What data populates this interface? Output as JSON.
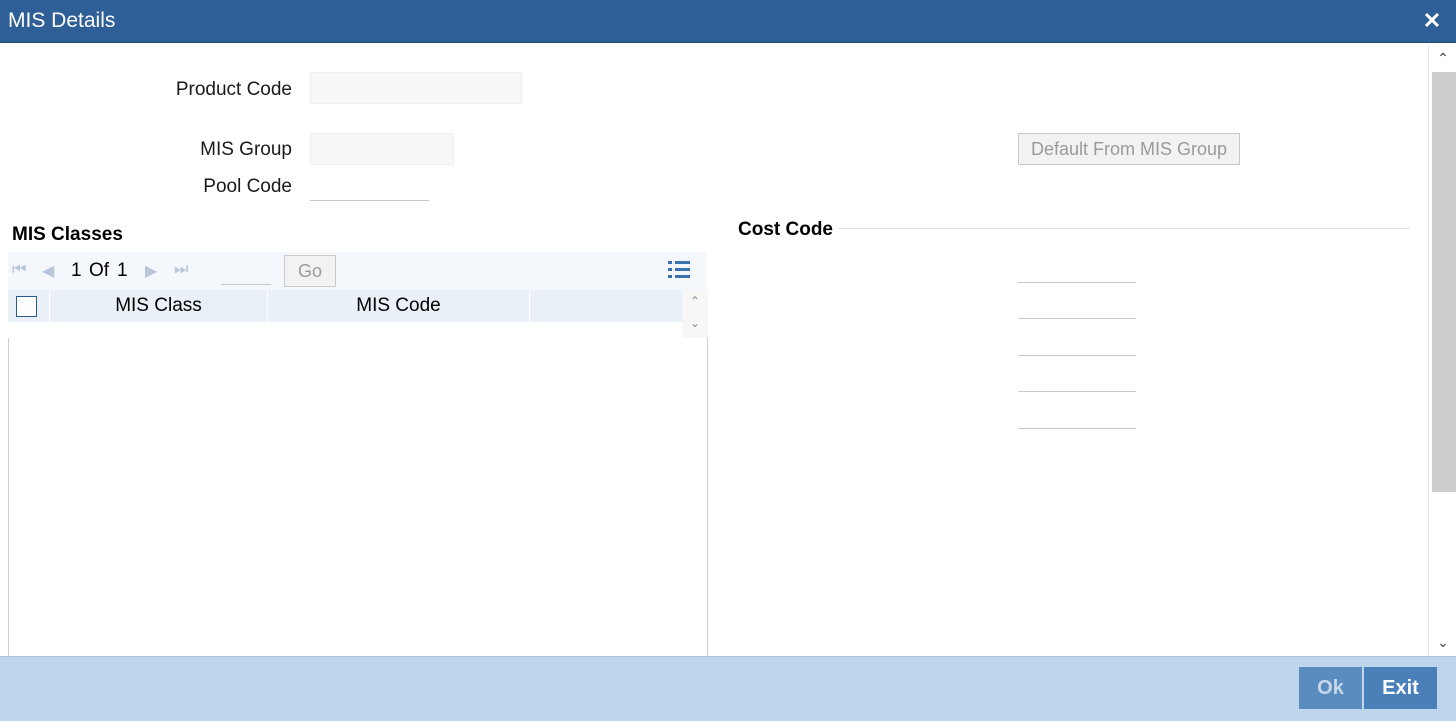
{
  "window": {
    "title": "MIS Details",
    "close_icon": "close-icon"
  },
  "form": {
    "product_code_label": "Product Code",
    "product_code_value": "",
    "mis_group_label": "MIS Group",
    "mis_group_value": "",
    "pool_code_label": "Pool Code",
    "pool_code_value": "",
    "default_button_label": "Default From MIS Group"
  },
  "mis_classes": {
    "title": "MIS Classes",
    "pager": {
      "current_page": "1",
      "of_label": "Of",
      "total_pages": "1",
      "page_input_value": "",
      "go_label": "Go"
    },
    "columns": [
      "MIS Class",
      "MIS Code"
    ],
    "rows": []
  },
  "cost_code": {
    "title": "Cost Code",
    "fields": [
      "",
      "",
      "",
      "",
      ""
    ]
  },
  "footer": {
    "ok_label": "Ok",
    "exit_label": "Exit"
  },
  "colors": {
    "titlebar": "#2f5f97",
    "footer": "#bed6eb",
    "button": "#4a7fb8"
  }
}
